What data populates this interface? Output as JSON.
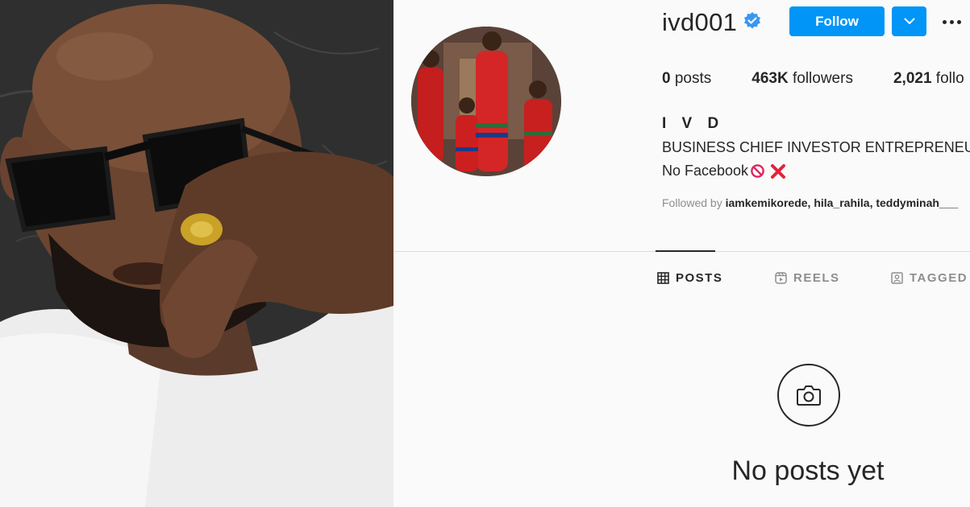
{
  "profile": {
    "username": "ivd001",
    "verified": true,
    "follow_label": "Follow",
    "stats": {
      "posts_count": "0",
      "posts_label": "posts",
      "followers_count": "463K",
      "followers_label": "followers",
      "following_count": "2,021",
      "following_label": "follo"
    },
    "display_name": "I V D",
    "bio_line1": "BUSINESS CHIEF INVESTOR ENTREPRENEUR",
    "bio_line2": "No Facebook",
    "followed_by_prefix": "Followed by",
    "followed_by_users": "iamkemikorede, hila_rahila, teddyminah___"
  },
  "tabs": [
    {
      "label": "POSTS",
      "icon": "grid-icon",
      "active": true
    },
    {
      "label": "REELS",
      "icon": "reels-icon",
      "active": false
    },
    {
      "label": "TAGGED",
      "icon": "tagged-icon",
      "active": false
    }
  ],
  "empty_state": {
    "icon": "camera-icon",
    "text": "No posts yet"
  },
  "colors": {
    "accent": "#0095f6",
    "text": "#262626",
    "muted": "#8e8e8e",
    "divider": "#dbdbdb",
    "verified": "#3897f0"
  }
}
